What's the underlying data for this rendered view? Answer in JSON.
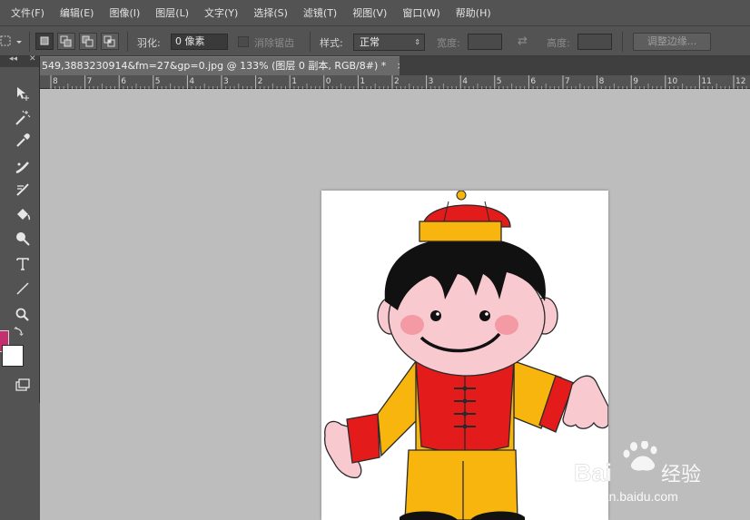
{
  "menu": [
    "文件(F)",
    "编辑(E)",
    "图像(I)",
    "图层(L)",
    "文字(Y)",
    "选择(S)",
    "滤镜(T)",
    "视图(V)",
    "窗口(W)",
    "帮助(H)"
  ],
  "options": {
    "feather_label": "羽化:",
    "feather_value": "0 像素",
    "antialias_label": "消除锯齿",
    "style_label": "样式:",
    "style_value": "正常",
    "width_label": "宽度:",
    "height_label": "高度:",
    "refine_edge_label": "调整边缘..."
  },
  "panel": {
    "collapse": "◂◂",
    "close": "✕"
  },
  "document": {
    "tab_title": "549,3883230914&fm=27&gp=0.jpg @ 133% (图层 0 副本, RGB/8#) *",
    "tab_close": "×"
  },
  "ruler_labels": [
    "8",
    "7",
    "6",
    "5",
    "4",
    "3",
    "2",
    "1",
    "0",
    "1",
    "2",
    "3",
    "4",
    "5",
    "6",
    "7",
    "8",
    "9",
    "10",
    "11",
    "12"
  ],
  "tools": [
    "move-icon",
    "magic-wand-icon",
    "eyedropper-icon",
    "healing-brush-icon",
    "history-brush-icon",
    "paint-bucket-icon",
    "dodge-icon",
    "type-icon",
    "line-icon",
    "zoom-icon",
    "swap-colors-icon",
    "screen-mode-icon"
  ],
  "colors": {
    "foreground": "#c2306d",
    "background": "#ffffff",
    "canvas_bg": "#bdbdbd"
  },
  "watermark": {
    "logo": "Bai",
    "logo_tail": "经验",
    "url": "jingyan.baidu.com"
  }
}
